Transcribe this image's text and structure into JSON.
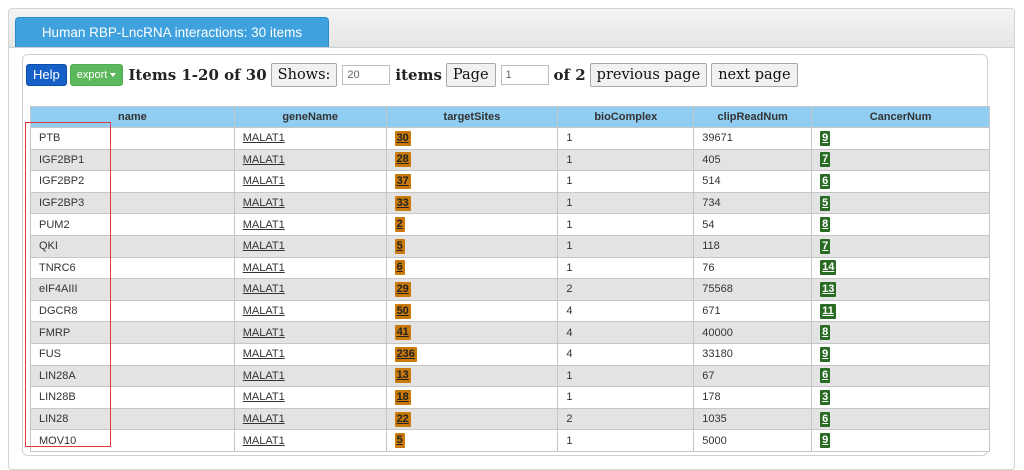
{
  "tab": {
    "label": "Human RBP-LncRNA interactions: 30 items"
  },
  "toolbar": {
    "help_label": "Help",
    "export_label": "export",
    "items_range": "Items 1-20 of 30",
    "shows_label": "Shows:",
    "shows_value": "20",
    "items_label": "items",
    "page_label": "Page",
    "page_value": "1",
    "of_pages": "of 2",
    "prev_label": "previous page",
    "next_label": "next page"
  },
  "table": {
    "columns": [
      "name",
      "geneName",
      "targetSites",
      "bioComplex",
      "clipReadNum",
      "CancerNum"
    ],
    "rows": [
      {
        "name": "PTB",
        "geneName": "MALAT1",
        "targetSites": "30",
        "bioComplex": "1",
        "clipReadNum": "39671",
        "cancerNum": "9"
      },
      {
        "name": "IGF2BP1",
        "geneName": "MALAT1",
        "targetSites": "28",
        "bioComplex": "1",
        "clipReadNum": "405",
        "cancerNum": "7"
      },
      {
        "name": "IGF2BP2",
        "geneName": "MALAT1",
        "targetSites": "37",
        "bioComplex": "1",
        "clipReadNum": "514",
        "cancerNum": "6"
      },
      {
        "name": "IGF2BP3",
        "geneName": "MALAT1",
        "targetSites": "33",
        "bioComplex": "1",
        "clipReadNum": "734",
        "cancerNum": "5"
      },
      {
        "name": "PUM2",
        "geneName": "MALAT1",
        "targetSites": "2",
        "bioComplex": "1",
        "clipReadNum": "54",
        "cancerNum": "8"
      },
      {
        "name": "QKI",
        "geneName": "MALAT1",
        "targetSites": "5",
        "bioComplex": "1",
        "clipReadNum": "118",
        "cancerNum": "7"
      },
      {
        "name": "TNRC6",
        "geneName": "MALAT1",
        "targetSites": "6",
        "bioComplex": "1",
        "clipReadNum": "76",
        "cancerNum": "14"
      },
      {
        "name": "eIF4AIII",
        "geneName": "MALAT1",
        "targetSites": "29",
        "bioComplex": "2",
        "clipReadNum": "75568",
        "cancerNum": "13"
      },
      {
        "name": "DGCR8",
        "geneName": "MALAT1",
        "targetSites": "50",
        "bioComplex": "4",
        "clipReadNum": "671",
        "cancerNum": "11"
      },
      {
        "name": "FMRP",
        "geneName": "MALAT1",
        "targetSites": "41",
        "bioComplex": "4",
        "clipReadNum": "40000",
        "cancerNum": "8"
      },
      {
        "name": "FUS",
        "geneName": "MALAT1",
        "targetSites": "236",
        "bioComplex": "4",
        "clipReadNum": "33180",
        "cancerNum": "9"
      },
      {
        "name": "LIN28A",
        "geneName": "MALAT1",
        "targetSites": "13",
        "bioComplex": "1",
        "clipReadNum": "67",
        "cancerNum": "6"
      },
      {
        "name": "LIN28B",
        "geneName": "MALAT1",
        "targetSites": "18",
        "bioComplex": "1",
        "clipReadNum": "178",
        "cancerNum": "3"
      },
      {
        "name": "LIN28",
        "geneName": "MALAT1",
        "targetSites": "22",
        "bioComplex": "2",
        "clipReadNum": "1035",
        "cancerNum": "6"
      },
      {
        "name": "MOV10",
        "geneName": "MALAT1",
        "targetSites": "5",
        "bioComplex": "1",
        "clipReadNum": "5000",
        "cancerNum": "9"
      }
    ]
  },
  "colors": {
    "tab_bg": "#3fa2de",
    "header_bg": "#90cdf2",
    "target_badge": "#c97a0a",
    "cancer_badge": "#2a6b24",
    "highlight_box": "#e03a3a"
  }
}
